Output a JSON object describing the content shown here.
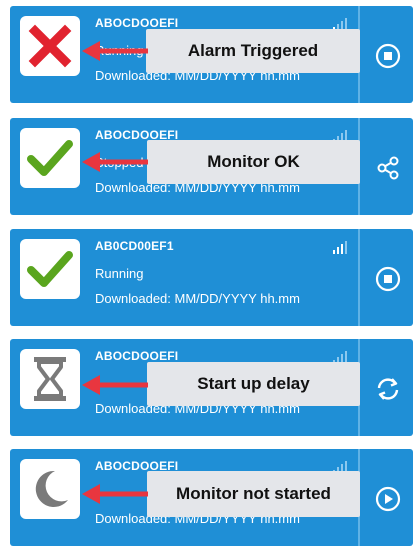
{
  "devices": [
    {
      "id": "ABOCDOOEFI",
      "status": "Running",
      "downloaded": "Downloaded: MM/DD/YYYY  hh.mm",
      "status_icon": "x-icon",
      "action_icon": "stop-icon",
      "callout": "Alarm Triggered"
    },
    {
      "id": "ABOCDOOEFI",
      "status": "Stopped",
      "downloaded": "Downloaded: MM/DD/YYYY  hh.mm",
      "status_icon": "checkmark-icon",
      "action_icon": "share-icon",
      "callout": "Monitor OK"
    },
    {
      "id": "AB0CD00EF1",
      "status": "Running",
      "downloaded": "Downloaded: MM/DD/YYYY  hh.mm",
      "status_icon": "checkmark-icon",
      "action_icon": "stop-icon",
      "callout": ""
    },
    {
      "id": "ABOCDOOEFI",
      "status": "",
      "downloaded": "Downloaded: MM/DD/YYYY  hh.mm",
      "status_icon": "hourglass-icon",
      "action_icon": "refresh-icon",
      "callout": "Start up delay"
    },
    {
      "id": "ABOCDOOEFI",
      "status": "",
      "downloaded": "Downloaded: MM/DD/YYYY  hh.mm",
      "status_icon": "moon-icon",
      "action_icon": "play-icon",
      "callout": "Monitor not started"
    }
  ],
  "colors": {
    "card_bg": "#1f8fd6",
    "alarm": "#e1232f",
    "ok": "#5aa51e",
    "neutral_icon": "#7a7a7a",
    "arrow": "#e8363f",
    "callout_bg": "#e4e6ea"
  }
}
